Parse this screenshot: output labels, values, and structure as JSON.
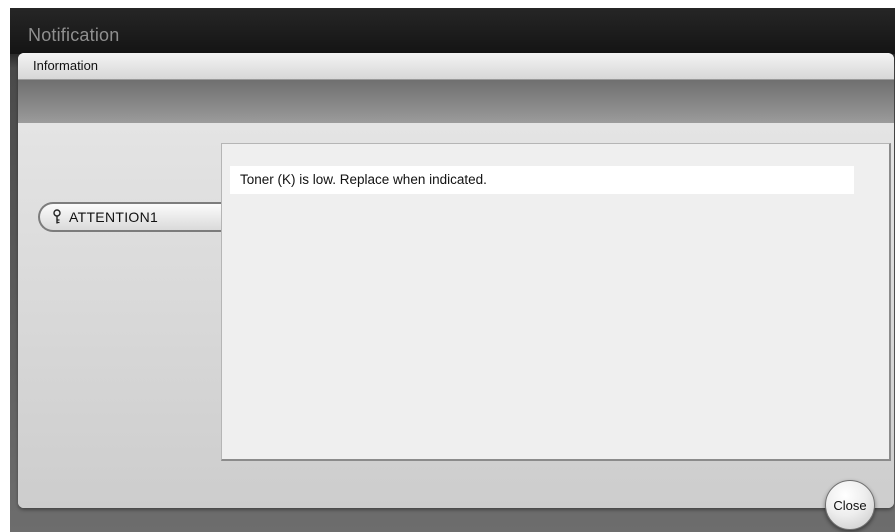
{
  "window": {
    "title": "Notification"
  },
  "panel": {
    "header": "Information"
  },
  "tabs": [
    {
      "label": "ATTENTION1",
      "icon": "key-icon"
    }
  ],
  "message": {
    "text": "Toner (K) is low. Replace when indicated."
  },
  "actions": {
    "close_label": "Close"
  }
}
